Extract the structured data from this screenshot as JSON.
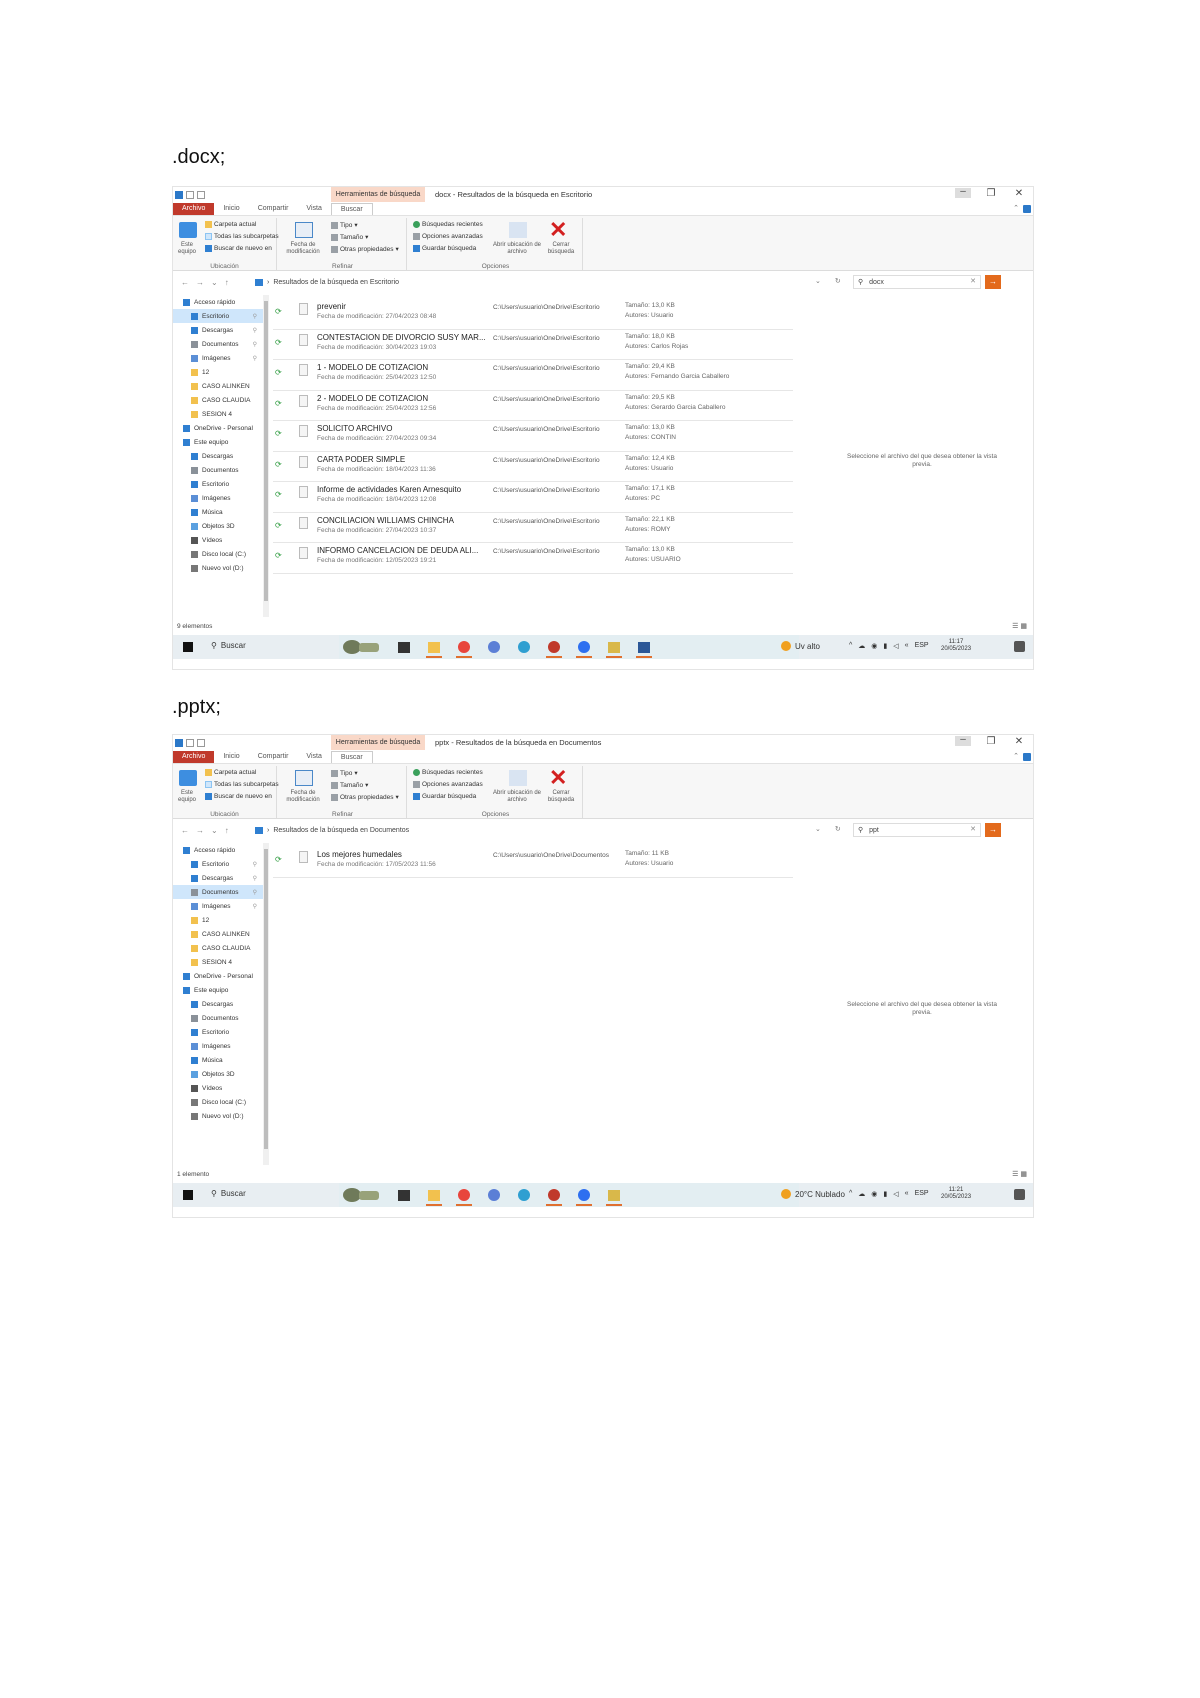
{
  "captions": [
    ".docx;",
    ".pptx;"
  ],
  "screenshots": [
    {
      "window_title": "docx - Resultados de la búsqueda en Escritorio",
      "context_tab": "Herramientas de búsqueda",
      "tabs": [
        "Archivo",
        "Inicio",
        "Compartir",
        "Vista",
        "Buscar"
      ],
      "ribbon": {
        "ubicacion": {
          "label": "Ubicación",
          "big_btn": "Este equipo",
          "items": [
            "Carpeta actual",
            "Todas las subcarpetas",
            "Buscar de nuevo en"
          ]
        },
        "refinar": {
          "label": "Refinar",
          "big_btn": "Fecha de modificación",
          "items": [
            "Tipo",
            "Tamaño",
            "Otras propiedades"
          ]
        },
        "opciones": {
          "label": "Opciones",
          "items": [
            "Búsquedas recientes",
            "Opciones avanzadas",
            "Guardar búsqueda"
          ],
          "open_location": "Abrir ubicación de archivo",
          "close": "Cerrar búsqueda"
        }
      },
      "address": "Resultados de la búsqueda en Escritorio",
      "search": "docx",
      "nav": [
        {
          "label": "Acceso rápido",
          "icon": "star-icon",
          "pin": false,
          "selected": false,
          "indent": 0
        },
        {
          "label": "Escritorio",
          "icon": "desktop-icon",
          "pin": true,
          "selected": true,
          "indent": 1
        },
        {
          "label": "Descargas",
          "icon": "download-icon",
          "pin": true,
          "selected": false,
          "indent": 1
        },
        {
          "label": "Documentos",
          "icon": "document-icon",
          "pin": true,
          "selected": false,
          "indent": 1
        },
        {
          "label": "Imágenes",
          "icon": "image-icon",
          "pin": true,
          "selected": false,
          "indent": 1
        },
        {
          "label": "12",
          "icon": "folder-icon",
          "pin": false,
          "selected": false,
          "indent": 1
        },
        {
          "label": "CASO ALINKEN",
          "icon": "folder-icon",
          "pin": false,
          "selected": false,
          "indent": 1
        },
        {
          "label": "CASO CLAUDIA",
          "icon": "folder-icon",
          "pin": false,
          "selected": false,
          "indent": 1
        },
        {
          "label": "SESION 4",
          "icon": "folder-icon",
          "pin": false,
          "selected": false,
          "indent": 1
        },
        {
          "label": "OneDrive - Personal",
          "icon": "cloud-icon",
          "pin": false,
          "selected": false,
          "indent": 0
        },
        {
          "label": "Este equipo",
          "icon": "computer-icon",
          "pin": false,
          "selected": false,
          "indent": 0
        },
        {
          "label": "Descargas",
          "icon": "download-icon",
          "pin": false,
          "selected": false,
          "indent": 1
        },
        {
          "label": "Documentos",
          "icon": "document-icon",
          "pin": false,
          "selected": false,
          "indent": 1
        },
        {
          "label": "Escritorio",
          "icon": "desktop-icon",
          "pin": false,
          "selected": false,
          "indent": 1
        },
        {
          "label": "Imágenes",
          "icon": "image-icon",
          "pin": false,
          "selected": false,
          "indent": 1
        },
        {
          "label": "Música",
          "icon": "music-icon",
          "pin": false,
          "selected": false,
          "indent": 1
        },
        {
          "label": "Objetos 3D",
          "icon": "cube-icon",
          "pin": false,
          "selected": false,
          "indent": 1
        },
        {
          "label": "Vídeos",
          "icon": "video-icon",
          "pin": false,
          "selected": false,
          "indent": 1
        },
        {
          "label": "Disco local (C:)",
          "icon": "drive-icon",
          "pin": false,
          "selected": false,
          "indent": 1
        },
        {
          "label": "Nuevo vol (D:)",
          "icon": "drive-icon",
          "pin": false,
          "selected": false,
          "indent": 1
        }
      ],
      "files": [
        {
          "name": "prevenir",
          "date": "Fecha de modificación: 27/04/2023 08:48",
          "path": "C:\\Users\\usuario\\OneDrive\\Escritorio",
          "size": "Tamaño: 13,0 KB",
          "author": "Autores: Usuario"
        },
        {
          "name": "CONTESTACION DE DIVORCIO SUSY MAR...",
          "date": "Fecha de modificación: 30/04/2023 19:03",
          "path": "C:\\Users\\usuario\\OneDrive\\Escritorio",
          "size": "Tamaño: 18,0 KB",
          "author": "Autores: Carlos Rojas"
        },
        {
          "name": "1 - MODELO DE COTIZACION",
          "date": "Fecha de modificación: 25/04/2023 12:50",
          "path": "C:\\Users\\usuario\\OneDrive\\Escritorio",
          "size": "Tamaño: 29,4 KB",
          "author": "Autores: Fernando Garcia Caballero"
        },
        {
          "name": "2 - MODELO DE COTIZACION",
          "date": "Fecha de modificación: 25/04/2023 12:56",
          "path": "C:\\Users\\usuario\\OneDrive\\Escritorio",
          "size": "Tamaño: 29,5 KB",
          "author": "Autores: Gerardo Garcia Caballero"
        },
        {
          "name": "SOLICITO ARCHIVO",
          "date": "Fecha de modificación: 27/04/2023 09:34",
          "path": "C:\\Users\\usuario\\OneDrive\\Escritorio",
          "size": "Tamaño: 13,0 KB",
          "author": "Autores: CONTIN"
        },
        {
          "name": "CARTA PODER SIMPLE",
          "date": "Fecha de modificación: 18/04/2023 11:36",
          "path": "C:\\Users\\usuario\\OneDrive\\Escritorio",
          "size": "Tamaño: 12,4 KB",
          "author": "Autores: Usuario"
        },
        {
          "name": "Informe de actividades Karen Arnesquito",
          "date": "Fecha de modificación: 18/04/2023 12:08",
          "path": "C:\\Users\\usuario\\OneDrive\\Escritorio",
          "size": "Tamaño: 17,1 KB",
          "author": "Autores: PC"
        },
        {
          "name": "CONCILIACION WILLIAMS CHINCHA",
          "date": "Fecha de modificación: 27/04/2023 10:37",
          "path": "C:\\Users\\usuario\\OneDrive\\Escritorio",
          "size": "Tamaño: 22,1 KB",
          "author": "Autores: ROMY"
        },
        {
          "name": "INFORMO CANCELACION DE DEUDA ALI...",
          "date": "Fecha de modificación: 12/05/2023 19:21",
          "path": "C:\\Users\\usuario\\OneDrive\\Escritorio",
          "size": "Tamaño: 13,0 KB",
          "author": "Autores: USUARIO"
        }
      ],
      "preview_message": "Seleccione el archivo del que desea obtener la vista previa.",
      "status_count": "9 elementos",
      "taskbar": {
        "search_label": "Buscar",
        "weather": "Uv alto",
        "clock_time": "11:17",
        "clock_date": "20/05/2023",
        "lang": "ESP"
      }
    },
    {
      "window_title": "pptx - Resultados de la búsqueda en Documentos",
      "context_tab": "Herramientas de búsqueda",
      "tabs": [
        "Archivo",
        "Inicio",
        "Compartir",
        "Vista",
        "Buscar"
      ],
      "ribbon": {
        "ubicacion": {
          "label": "Ubicación",
          "big_btn": "Este equipo",
          "items": [
            "Carpeta actual",
            "Todas las subcarpetas",
            "Buscar de nuevo en"
          ]
        },
        "refinar": {
          "label": "Refinar",
          "big_btn": "Fecha de modificación",
          "items": [
            "Tipo",
            "Tamaño",
            "Otras propiedades"
          ]
        },
        "opciones": {
          "label": "Opciones",
          "items": [
            "Búsquedas recientes",
            "Opciones avanzadas",
            "Guardar búsqueda"
          ],
          "open_location": "Abrir ubicación de archivo",
          "close": "Cerrar búsqueda"
        }
      },
      "address": "Resultados de la búsqueda en Documentos",
      "search": "ppt",
      "nav": [
        {
          "label": "Acceso rápido",
          "icon": "star-icon",
          "pin": false,
          "selected": false,
          "indent": 0
        },
        {
          "label": "Escritorio",
          "icon": "desktop-icon",
          "pin": true,
          "selected": false,
          "indent": 1
        },
        {
          "label": "Descargas",
          "icon": "download-icon",
          "pin": true,
          "selected": false,
          "indent": 1
        },
        {
          "label": "Documentos",
          "icon": "document-icon",
          "pin": true,
          "selected": true,
          "indent": 1
        },
        {
          "label": "Imágenes",
          "icon": "image-icon",
          "pin": true,
          "selected": false,
          "indent": 1
        },
        {
          "label": "12",
          "icon": "folder-icon",
          "pin": false,
          "selected": false,
          "indent": 1
        },
        {
          "label": "CASO ALINKEN",
          "icon": "folder-icon",
          "pin": false,
          "selected": false,
          "indent": 1
        },
        {
          "label": "CASO CLAUDIA",
          "icon": "folder-icon",
          "pin": false,
          "selected": false,
          "indent": 1
        },
        {
          "label": "SESION 4",
          "icon": "folder-icon",
          "pin": false,
          "selected": false,
          "indent": 1
        },
        {
          "label": "OneDrive - Personal",
          "icon": "cloud-icon",
          "pin": false,
          "selected": false,
          "indent": 0
        },
        {
          "label": "Este equipo",
          "icon": "computer-icon",
          "pin": false,
          "selected": false,
          "indent": 0
        },
        {
          "label": "Descargas",
          "icon": "download-icon",
          "pin": false,
          "selected": false,
          "indent": 1
        },
        {
          "label": "Documentos",
          "icon": "document-icon",
          "pin": false,
          "selected": false,
          "indent": 1
        },
        {
          "label": "Escritorio",
          "icon": "desktop-icon",
          "pin": false,
          "selected": false,
          "indent": 1
        },
        {
          "label": "Imágenes",
          "icon": "image-icon",
          "pin": false,
          "selected": false,
          "indent": 1
        },
        {
          "label": "Música",
          "icon": "music-icon",
          "pin": false,
          "selected": false,
          "indent": 1
        },
        {
          "label": "Objetos 3D",
          "icon": "cube-icon",
          "pin": false,
          "selected": false,
          "indent": 1
        },
        {
          "label": "Vídeos",
          "icon": "video-icon",
          "pin": false,
          "selected": false,
          "indent": 1
        },
        {
          "label": "Disco local (C:)",
          "icon": "drive-icon",
          "pin": false,
          "selected": false,
          "indent": 1
        },
        {
          "label": "Nuevo vol (D:)",
          "icon": "drive-icon",
          "pin": false,
          "selected": false,
          "indent": 1
        }
      ],
      "files": [
        {
          "name": "Los mejores humedales",
          "date": "Fecha de modificación: 17/05/2023 11:56",
          "path": "C:\\Users\\usuario\\OneDrive\\Documentos",
          "size": "Tamaño: 11 KB",
          "author": "Autores: Usuario"
        }
      ],
      "preview_message": "Seleccione el archivo del que desea obtener la vista previa.",
      "status_count": "1 elemento",
      "taskbar": {
        "search_label": "Buscar",
        "weather": "20°C Nublado",
        "clock_time": "11:21",
        "clock_date": "20/05/2023",
        "lang": "ESP"
      }
    }
  ]
}
